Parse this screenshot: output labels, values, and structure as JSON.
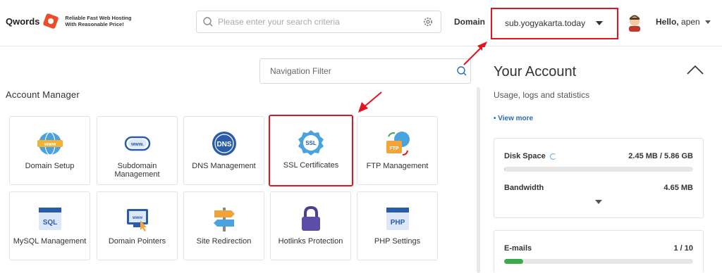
{
  "brand": {
    "name": "Qwords",
    "tagline_1": "Reliable Fast Web Hosting",
    "tagline_2": "With Reasonable Price!"
  },
  "search": {
    "placeholder": "Please enter your search criteria"
  },
  "domain": {
    "label": "Domain",
    "value": "sub.yogyakarta.today"
  },
  "user": {
    "greeting": "Hello,",
    "name": "apen"
  },
  "nav_filter": {
    "placeholder": "Navigation Filter"
  },
  "section": {
    "title": "Account Manager"
  },
  "tiles": [
    {
      "label": "Domain Setup",
      "icon": "www-globe-icon"
    },
    {
      "label": "Subdomain Management",
      "icon": "subdomain-icon"
    },
    {
      "label": "DNS Management",
      "icon": "dns-icon"
    },
    {
      "label": "SSL Certificates",
      "icon": "ssl-badge-icon"
    },
    {
      "label": "FTP Management",
      "icon": "ftp-icon"
    },
    {
      "label": "MySQL Management",
      "icon": "sql-icon"
    },
    {
      "label": "Domain Pointers",
      "icon": "domain-pointer-icon"
    },
    {
      "label": "Site Redirection",
      "icon": "signpost-icon"
    },
    {
      "label": "Hotlinks Protection",
      "icon": "lock-icon"
    },
    {
      "label": "PHP Settings",
      "icon": "php-icon"
    }
  ],
  "account": {
    "title": "Your Account",
    "subtitle": "Usage, logs and statistics",
    "view_more": "• View more",
    "disk_label": "Disk Space",
    "disk_value": "2.45 MB / 5.86 GB",
    "disk_fraction": 0.0004,
    "bandwidth_label": "Bandwidth",
    "bandwidth_value": "4.65 MB",
    "emails_label": "E-mails",
    "emails_value": "1 / 10",
    "emails_fraction": 0.1
  },
  "colors": {
    "highlight": "#e2141d",
    "accent": "#2a6bb0",
    "progress": "#3aaa4a"
  }
}
